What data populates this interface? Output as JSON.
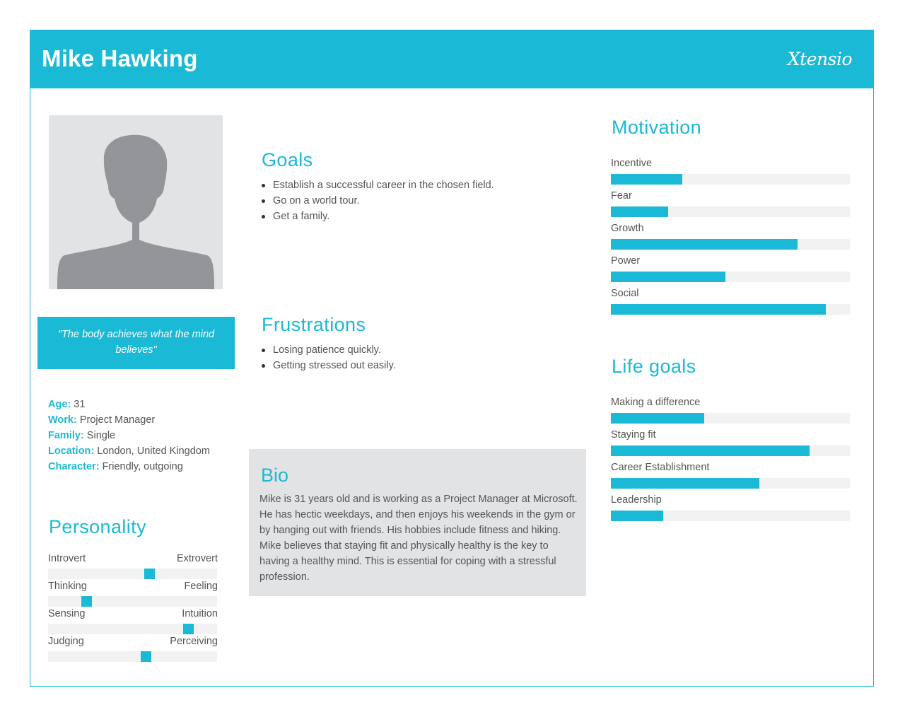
{
  "header": {
    "name": "Mike Hawking",
    "logo": "Xtensio"
  },
  "quote": "\"The body achieves what the mind believes\"",
  "facts": [
    {
      "key": "Age",
      "value": " 31"
    },
    {
      "key": "Work",
      "value": " Project Manager"
    },
    {
      "key": "Family",
      "value": " Single"
    },
    {
      "key": "Location",
      "value": " London, United Kingdom"
    },
    {
      "key": "Character",
      "value": " Friendly, outgoing"
    }
  ],
  "goals": {
    "title": "Goals",
    "items": [
      "Establish a successful career in the chosen field.",
      "Go on a world tour.",
      "Get a family."
    ]
  },
  "frustrations": {
    "title": "Frustrations",
    "items": [
      "Losing patience quickly.",
      "Getting stressed out easily."
    ]
  },
  "bio": {
    "title": "Bio",
    "text": "Mike is 31 years old and is working as a  Project Manager at Microsoft. He has hectic weekdays, and then enjoys his weekends in the gym or by hanging out with friends. His hobbies include fitness and hiking. Mike believes that staying fit and physically healthy is the key to having a healthy mind. This is essential for coping with a stressful profession."
  },
  "personality": {
    "title": "Personality",
    "traits": [
      {
        "left": "Introvert",
        "right": "Extrovert",
        "value": 0.6
      },
      {
        "left": "Thinking",
        "right": "Feeling",
        "value": 0.23
      },
      {
        "left": "Sensing",
        "right": "Intuition",
        "value": 0.83
      },
      {
        "left": "Judging",
        "right": "Perceiving",
        "value": 0.58
      }
    ]
  },
  "motivation": {
    "title": "Motivation",
    "items": [
      {
        "label": "Incentive",
        "value": 0.3
      },
      {
        "label": "Fear",
        "value": 0.24
      },
      {
        "label": "Growth",
        "value": 0.78
      },
      {
        "label": "Power",
        "value": 0.48
      },
      {
        "label": "Social",
        "value": 0.9
      }
    ]
  },
  "life_goals": {
    "title": "Life goals",
    "items": [
      {
        "label": "Making a difference",
        "value": 0.39
      },
      {
        "label": "Staying fit",
        "value": 0.83
      },
      {
        "label": "Career Establishment",
        "value": 0.62
      },
      {
        "label": "Leadership",
        "value": 0.22
      }
    ]
  },
  "colors": {
    "accent": "#1ab9d6",
    "panel": "#e2e3e4",
    "track": "#f2f2f2",
    "avatar": "#939598"
  }
}
